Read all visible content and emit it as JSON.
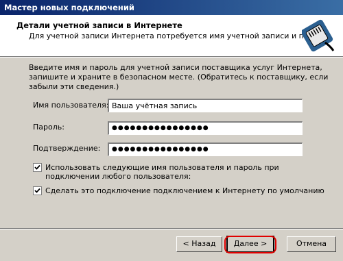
{
  "window": {
    "title": "Мастер новых подключений"
  },
  "header": {
    "title": "Детали учетной записи в Интернете",
    "subtitle": "Для учетной записи Интернета потребуется имя учетной записи и пароль."
  },
  "description": "Введите имя и пароль для учетной записи поставщика услуг Интернета, запишите и храните в безопасном месте. (Обратитесь к поставщику, если забыли эти сведения.)",
  "form": {
    "username_label": "Имя пользователя:",
    "username_value": "Ваша учётная запись",
    "password_label": "Пароль:",
    "password_value": "●●●●●●●●●●●●●●●●",
    "confirm_label": "Подтверждение:",
    "confirm_value": "●●●●●●●●●●●●●●●●"
  },
  "options": {
    "use_for_all_label": "Использовать следующие имя пользователя и пароль при подключении любого пользователя:",
    "use_for_all_checked": true,
    "default_connection_label": "Сделать это подключение подключением к Интернету по умолчанию",
    "default_connection_checked": true
  },
  "buttons": {
    "back": "< Назад",
    "next": "Далее >",
    "cancel": "Отмена"
  },
  "icons": [
    "cable-connector-icon",
    "checkmark-icon"
  ]
}
